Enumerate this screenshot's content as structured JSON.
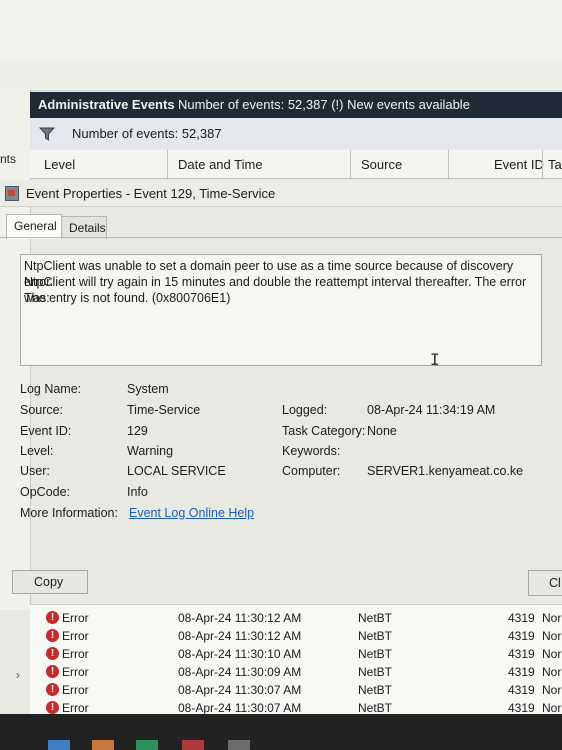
{
  "window": {
    "left_tab_label": "nts"
  },
  "admin_header": {
    "title": "Administrative Events",
    "status": "Number of events: 52,387 (!) New events available"
  },
  "filter_bar": {
    "icon": "funnel-icon",
    "text": "Number of events: 52,387"
  },
  "columns": [
    "Level",
    "Date and Time",
    "Source",
    "Event ID",
    "Ta"
  ],
  "dialog": {
    "title": "Event Properties - Event 129, Time-Service",
    "tabs": [
      {
        "label": "General",
        "active": true
      },
      {
        "label": "Details",
        "active": false
      }
    ],
    "description_lines": [
      "NtpClient was unable to set a domain peer to use as a time source because of discovery error.",
      "NtpClient will try again in 15 minutes and double the reattempt interval thereafter. The error was:",
      "The entry is not found. (0x800706E1)"
    ],
    "props": {
      "log_name": {
        "label": "Log Name:",
        "value": "System"
      },
      "source": {
        "label": "Source:",
        "value": "Time-Service"
      },
      "logged": {
        "label": "Logged:",
        "value": "08-Apr-24 11:34:19 AM"
      },
      "event_id": {
        "label": "Event ID:",
        "value": "129"
      },
      "task_category": {
        "label": "Task Category:",
        "value": "None"
      },
      "level": {
        "label": "Level:",
        "value": "Warning"
      },
      "keywords": {
        "label": "Keywords:",
        "value": ""
      },
      "user": {
        "label": "User:",
        "value": "LOCAL SERVICE"
      },
      "computer": {
        "label": "Computer:",
        "value": "SERVER1.kenyameat.co.ke"
      },
      "opcode": {
        "label": "OpCode:",
        "value": "Info"
      },
      "more_info": {
        "label": "More Information:",
        "value": "Event Log Online Help"
      }
    },
    "copy_label": "Copy",
    "close_label": "Cl"
  },
  "event_rows": [
    {
      "level": "Error",
      "datetime": "08-Apr-24 11:30:12 AM",
      "source": "NetBT",
      "event_id": "4319",
      "task": "Nor"
    },
    {
      "level": "Error",
      "datetime": "08-Apr-24 11:30:12 AM",
      "source": "NetBT",
      "event_id": "4319",
      "task": "Nor"
    },
    {
      "level": "Error",
      "datetime": "08-Apr-24 11:30:10 AM",
      "source": "NetBT",
      "event_id": "4319",
      "task": "Nor"
    },
    {
      "level": "Error",
      "datetime": "08-Apr-24 11:30:09 AM",
      "source": "NetBT",
      "event_id": "4319",
      "task": "Nor"
    },
    {
      "level": "Error",
      "datetime": "08-Apr-24 11:30:07 AM",
      "source": "NetBT",
      "event_id": "4319",
      "task": "Nor"
    },
    {
      "level": "Error",
      "datetime": "08-Apr-24 11:30:07 AM",
      "source": "NetBT",
      "event_id": "4319",
      "task": "Nor"
    }
  ],
  "colors": {
    "header_bg": "#1f2a36",
    "link": "#1d5fb8",
    "error_icon": "#c42b2b"
  }
}
